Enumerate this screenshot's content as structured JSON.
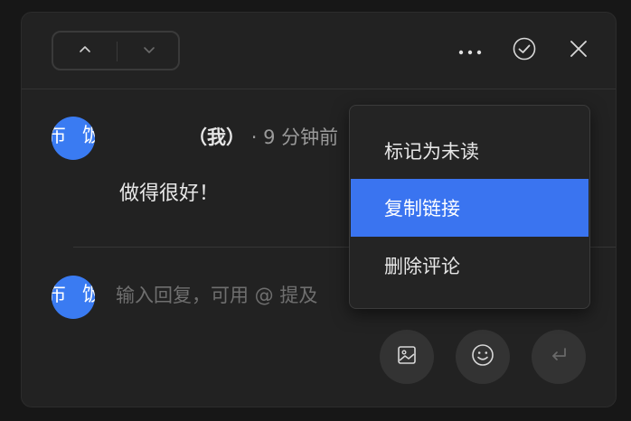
{
  "header": {
    "prev_icon": "chevron-up-icon",
    "next_icon": "chevron-down-icon",
    "more_icon": "more-horizontal-icon",
    "resolve_icon": "check-circle-icon",
    "close_icon": "close-icon"
  },
  "comment": {
    "author_self": "（我）",
    "separator": "·",
    "time": "9 分钟前",
    "text": "做得很好！",
    "avatar_color": "#3a7bf2"
  },
  "reply": {
    "placeholder": "输入回复，可用 @ 提及"
  },
  "actions": {
    "image_icon": "image-icon",
    "emoji_icon": "emoji-icon",
    "send_icon": "enter-icon"
  },
  "context_menu": {
    "items": [
      {
        "label": "标记为未读",
        "active": false
      },
      {
        "label": "复制链接",
        "active": true
      },
      {
        "label": "删除评论",
        "active": false
      }
    ],
    "active_color": "#3a74f0"
  }
}
